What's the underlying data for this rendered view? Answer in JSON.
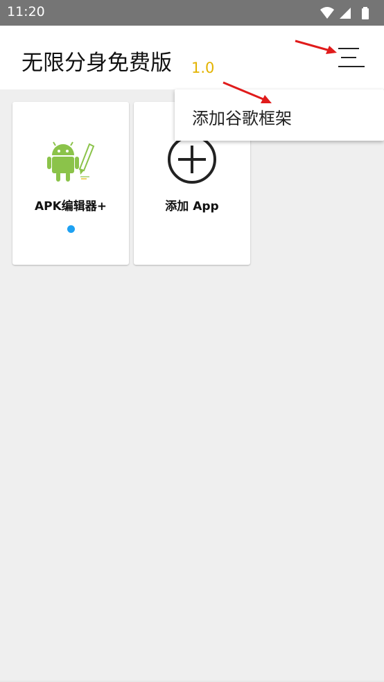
{
  "status_bar": {
    "time": "11:20",
    "icons": [
      "wifi-icon",
      "signal-icon",
      "battery-icon"
    ]
  },
  "app_bar": {
    "title": "无限分身免费版",
    "version": "1.0",
    "menu_icon": "menu-lines-icon"
  },
  "dropdown": {
    "items": [
      {
        "label": "添加谷歌框架"
      }
    ]
  },
  "cards": [
    {
      "label": "APK编辑器+",
      "icon": "android-editor-icon",
      "has_dot": true
    },
    {
      "label": "添加 App",
      "icon": "add-circle-icon",
      "has_dot": false
    }
  ],
  "colors": {
    "status_bar": "#757575",
    "app_bar": "#ffffff",
    "background": "#efefef",
    "version": "#e3b300",
    "dot": "#1ea1f2",
    "annotation_arrow": "#e01b1b"
  }
}
